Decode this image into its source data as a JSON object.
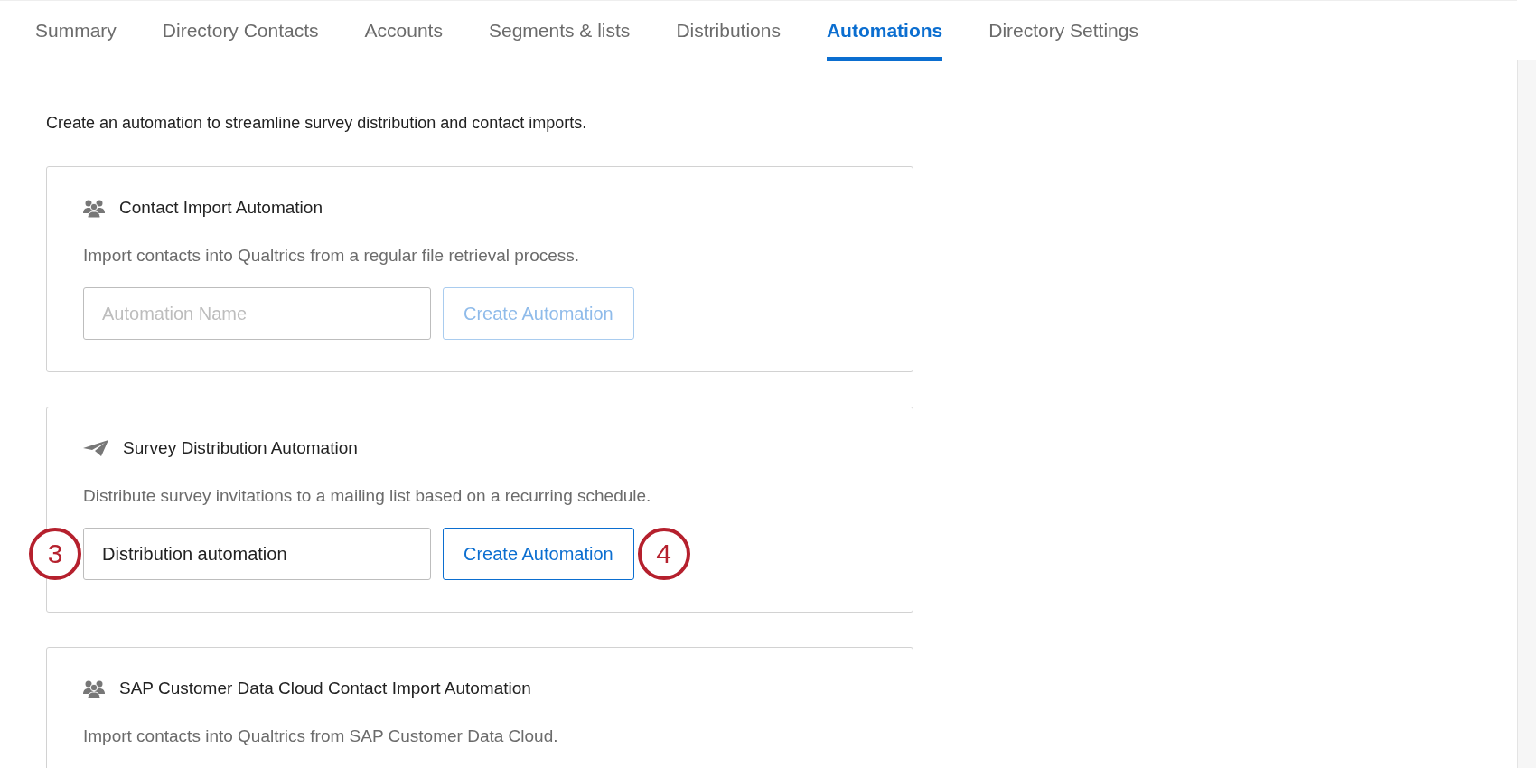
{
  "tabs": [
    {
      "label": "Summary",
      "selected": false
    },
    {
      "label": "Directory Contacts",
      "selected": false
    },
    {
      "label": "Accounts",
      "selected": false
    },
    {
      "label": "Segments & lists",
      "selected": false
    },
    {
      "label": "Distributions",
      "selected": false
    },
    {
      "label": "Automations",
      "selected": true
    },
    {
      "label": "Directory Settings",
      "selected": false
    }
  ],
  "intro": "Create an automation to streamline survey distribution and contact imports.",
  "cards": [
    {
      "kind": "people",
      "title": "Contact Import Automation",
      "description": "Import contacts into Qualtrics from a regular file retrieval process.",
      "field": {
        "placeholder": "Automation Name"
      },
      "button": {
        "label": "Create Automation",
        "disabled": true
      }
    },
    {
      "kind": "plane",
      "title": "Survey Distribution Automation",
      "description": "Distribute survey invitations to a mailing list based on a recurring schedule.",
      "field": {
        "value": "Distribution automation",
        "callout": "3"
      },
      "button": {
        "label": "Create Automation",
        "disabled": false,
        "callout": "4"
      }
    },
    {
      "kind": "people",
      "title": "SAP Customer Data Cloud Contact Import Automation",
      "description": "Import contacts into Qualtrics from SAP Customer Data Cloud."
    }
  ]
}
